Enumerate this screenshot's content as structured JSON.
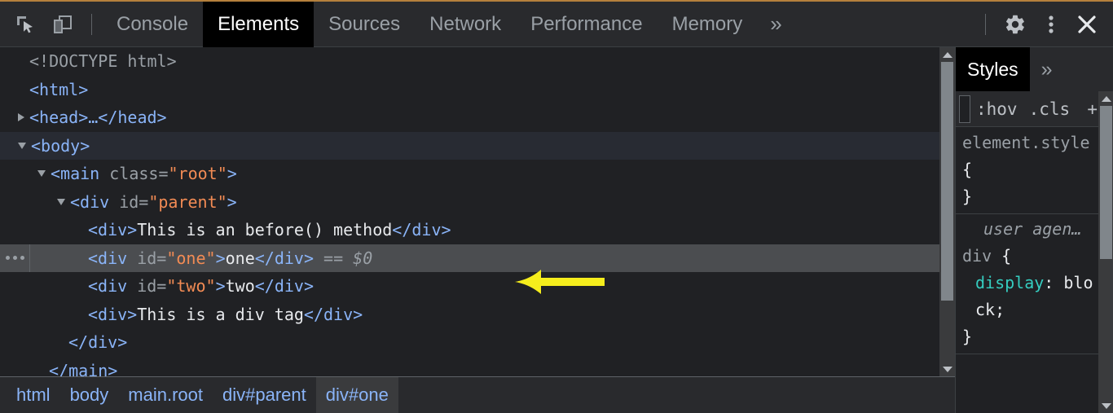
{
  "toolbar": {
    "inspect_icon": "inspect-element-icon",
    "device_icon": "device-toolbar-icon",
    "tabs": [
      {
        "label": "Console",
        "active": false
      },
      {
        "label": "Elements",
        "active": true
      },
      {
        "label": "Sources",
        "active": false
      },
      {
        "label": "Network",
        "active": false
      },
      {
        "label": "Performance",
        "active": false
      },
      {
        "label": "Memory",
        "active": false
      }
    ],
    "more_tabs_label": "»",
    "settings_icon": "gear-icon",
    "menu_icon": "kebab-menu-icon",
    "close_icon": "close-icon"
  },
  "dom_tree": {
    "rows": [
      {
        "indent": 0,
        "twisty": "none",
        "gutter": false,
        "selected": "none",
        "tokens": [
          {
            "t": "doctype",
            "v": "<!DOCTYPE html>"
          }
        ]
      },
      {
        "indent": 0,
        "twisty": "none",
        "gutter": false,
        "selected": "none",
        "tokens": [
          {
            "t": "punct",
            "v": "<html>"
          }
        ]
      },
      {
        "indent": 0,
        "twisty": "closed",
        "gutter": false,
        "selected": "none",
        "tokens": [
          {
            "t": "punct",
            "v": "<head>…</head>"
          }
        ]
      },
      {
        "indent": 0,
        "twisty": "open",
        "gutter": false,
        "selected": "body",
        "tokens": [
          {
            "t": "punct",
            "v": "<body>"
          }
        ]
      },
      {
        "indent": 1,
        "twisty": "open",
        "gutter": false,
        "selected": "none",
        "tokens": [
          {
            "t": "punct",
            "v": "<main "
          },
          {
            "t": "attr",
            "v": "class="
          },
          {
            "t": "value",
            "v": "\"root\""
          },
          {
            "t": "punct",
            "v": ">"
          }
        ]
      },
      {
        "indent": 2,
        "twisty": "open",
        "gutter": false,
        "selected": "none",
        "tokens": [
          {
            "t": "punct",
            "v": "<div "
          },
          {
            "t": "attr",
            "v": "id="
          },
          {
            "t": "value",
            "v": "\"parent\""
          },
          {
            "t": "punct",
            "v": ">"
          }
        ]
      },
      {
        "indent": 3,
        "twisty": "none",
        "gutter": false,
        "selected": "none",
        "tokens": [
          {
            "t": "punct",
            "v": "<div>"
          },
          {
            "t": "text",
            "v": "This is an before() method"
          },
          {
            "t": "punct",
            "v": "</div>"
          }
        ]
      },
      {
        "indent": 3,
        "twisty": "none",
        "gutter": true,
        "selected": "one",
        "tokens": [
          {
            "t": "punct",
            "v": "<div "
          },
          {
            "t": "attr",
            "v": "id="
          },
          {
            "t": "value",
            "v": "\"one\""
          },
          {
            "t": "punct",
            "v": ">"
          },
          {
            "t": "text",
            "v": "one"
          },
          {
            "t": "punct",
            "v": "</div>"
          },
          {
            "t": "ref",
            "v": " == $0"
          }
        ]
      },
      {
        "indent": 3,
        "twisty": "none",
        "gutter": false,
        "selected": "none",
        "tokens": [
          {
            "t": "punct",
            "v": "<div "
          },
          {
            "t": "attr",
            "v": "id="
          },
          {
            "t": "value",
            "v": "\"two\""
          },
          {
            "t": "punct",
            "v": ">"
          },
          {
            "t": "text",
            "v": "two"
          },
          {
            "t": "punct",
            "v": "</div>"
          }
        ]
      },
      {
        "indent": 3,
        "twisty": "none",
        "gutter": false,
        "selected": "none",
        "tokens": [
          {
            "t": "punct",
            "v": "<div>"
          },
          {
            "t": "text",
            "v": "This is a div tag"
          },
          {
            "t": "punct",
            "v": "</div>"
          }
        ]
      },
      {
        "indent": 2,
        "twisty": "none",
        "gutter": false,
        "selected": "none",
        "tokens": [
          {
            "t": "punct",
            "v": "</div>"
          }
        ]
      },
      {
        "indent": 1,
        "twisty": "none",
        "gutter": false,
        "selected": "none",
        "tokens": [
          {
            "t": "punct",
            "v": "</main>"
          }
        ]
      }
    ]
  },
  "annotation": {
    "arrow_color": "#f5ed1c",
    "arrow_direction": "left",
    "points_at": "This is an before() method"
  },
  "breadcrumb": {
    "items": [
      {
        "label": "html",
        "active": false
      },
      {
        "label": "body",
        "active": false
      },
      {
        "label": "main.root",
        "active": false
      },
      {
        "label": "div#parent",
        "active": false
      },
      {
        "label": "div#one",
        "active": true
      }
    ]
  },
  "styles_panel": {
    "tabs": [
      {
        "label": "Styles",
        "active": true
      }
    ],
    "more_label": "»",
    "filter_bar": {
      "hov_label": ":hov",
      "cls_label": ".cls",
      "plus_label": "+"
    },
    "rules": [
      {
        "origin": "",
        "selector": "element.style",
        "open_brace": " {",
        "close_brace": "}",
        "declarations": []
      },
      {
        "origin": "user agen…",
        "selector": "div",
        "open_brace": " {",
        "close_brace": "}",
        "declarations": [
          {
            "name": "display",
            "colon": ":",
            "value": "block;"
          }
        ]
      }
    ]
  },
  "colors": {
    "background": "#202124",
    "toolbar_bg": "#292a2d",
    "accent_orange": "#b5803c",
    "tag_blue": "#8ab4f8",
    "attr_value_orange": "#f28b54",
    "text_white": "#e8eaed",
    "muted_gray": "#9aa0a6",
    "prop_teal": "#35cdc0",
    "annotation_yellow": "#f5ed1c"
  }
}
